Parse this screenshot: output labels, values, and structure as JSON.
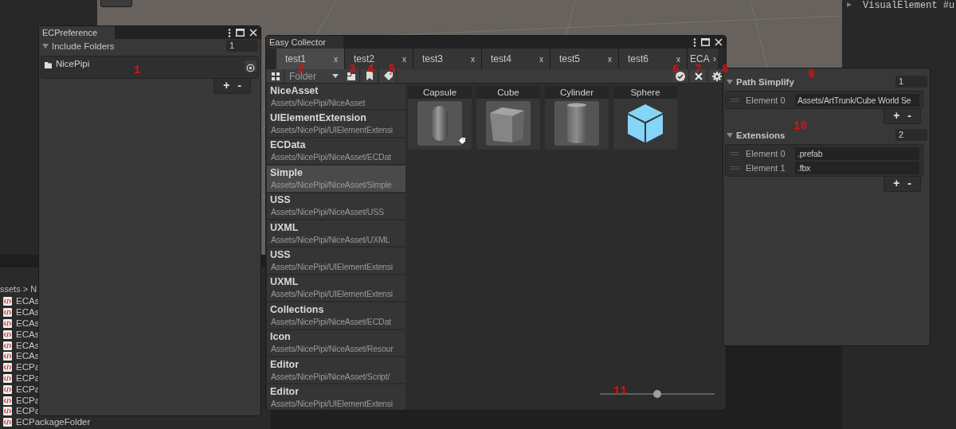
{
  "console": {
    "arrow": "▶",
    "text": "VisualElement #u"
  },
  "project": {
    "breadcrumb": "ssets > N",
    "files": [
      "ECAs",
      "ECAs",
      "ECAs",
      "ECAs",
      "ECAs",
      "ECAs",
      "ECPa",
      "ECPa",
      "ECPa",
      "ECPa",
      "ECPa",
      "ECPackageFolder"
    ]
  },
  "preference_window": {
    "title": "ECPreference",
    "section": {
      "label": "Include Folders",
      "expanded": true,
      "count": "1"
    },
    "folders": [
      "NicePipi"
    ],
    "add": "+",
    "remove": "-"
  },
  "collector_window": {
    "title": "Easy Collector",
    "tabs": [
      {
        "label": "test1",
        "close": "x",
        "selected": true
      },
      {
        "label": "test2",
        "close": "x",
        "selected": false
      },
      {
        "label": "test3",
        "close": "x",
        "selected": false
      },
      {
        "label": "test4",
        "close": "x",
        "selected": false
      },
      {
        "label": "test5",
        "close": "x",
        "selected": false
      },
      {
        "label": "test6",
        "close": "x",
        "selected": false
      }
    ],
    "overflow_tab": {
      "label": "ECA",
      "arrow": "›"
    },
    "toolbar": {
      "dropdown": "Folder"
    },
    "folders": [
      {
        "name": "NiceAsset",
        "path": "Assets/NicePipi/NiceAsset",
        "selected": false
      },
      {
        "name": "UIElementExtension",
        "path": "Assets/NicePipi/UIElementExtensi",
        "selected": false
      },
      {
        "name": "ECData",
        "path": "Assets/NicePipi/NiceAsset/ECDat",
        "selected": false
      },
      {
        "name": "Simple",
        "path": "Assets/NicePipi/NiceAsset/Simple",
        "selected": true
      },
      {
        "name": "USS",
        "path": "Assets/NicePipi/NiceAsset/USS",
        "selected": false
      },
      {
        "name": "UXML",
        "path": "Assets/NicePipi/NiceAsset/UXML",
        "selected": false
      },
      {
        "name": "USS",
        "path": "Assets/NicePipi/UIElementExtensi",
        "selected": false
      },
      {
        "name": "UXML",
        "path": "Assets/NicePipi/UIElementExtensi",
        "selected": false
      },
      {
        "name": "Collections",
        "path": "Assets/NicePipi/NiceAsset/ECDat",
        "selected": false
      },
      {
        "name": "Icon",
        "path": "Assets/NicePipi/NiceAsset/Resour",
        "selected": false
      },
      {
        "name": "Editor",
        "path": "Assets/NicePipi/NiceAsset/Script/",
        "selected": false
      },
      {
        "name": "Editor",
        "path": "Assets/NicePipi/UIElementExtensi",
        "selected": false
      }
    ],
    "assets": [
      {
        "name": "Capsule",
        "kind": "capsule",
        "tagged": true
      },
      {
        "name": "Cube",
        "kind": "cube",
        "tagged": false
      },
      {
        "name": "Cylinder",
        "kind": "cylinder",
        "tagged": false
      },
      {
        "name": "Sphere",
        "kind": "prefab",
        "tagged": false
      }
    ],
    "zoom_slider": {
      "level": 0.5
    }
  },
  "settings_panel": {
    "add": "+",
    "remove": "-",
    "sections": [
      {
        "label": "Path Simplify",
        "expanded": true,
        "count": "1",
        "elements": [
          {
            "label": "Element 0",
            "value": "Assets/ArtTrunk/Cube World Se"
          }
        ]
      },
      {
        "label": "Extensions",
        "expanded": true,
        "count": "2",
        "elements": [
          {
            "label": "Element 0",
            "value": ".prefab"
          },
          {
            "label": "Element 1",
            "value": ".fbx"
          }
        ]
      }
    ]
  },
  "annotations": [
    "1",
    "2",
    "3",
    "4",
    "5",
    "6",
    "7",
    "8",
    "9",
    "10",
    "11"
  ]
}
